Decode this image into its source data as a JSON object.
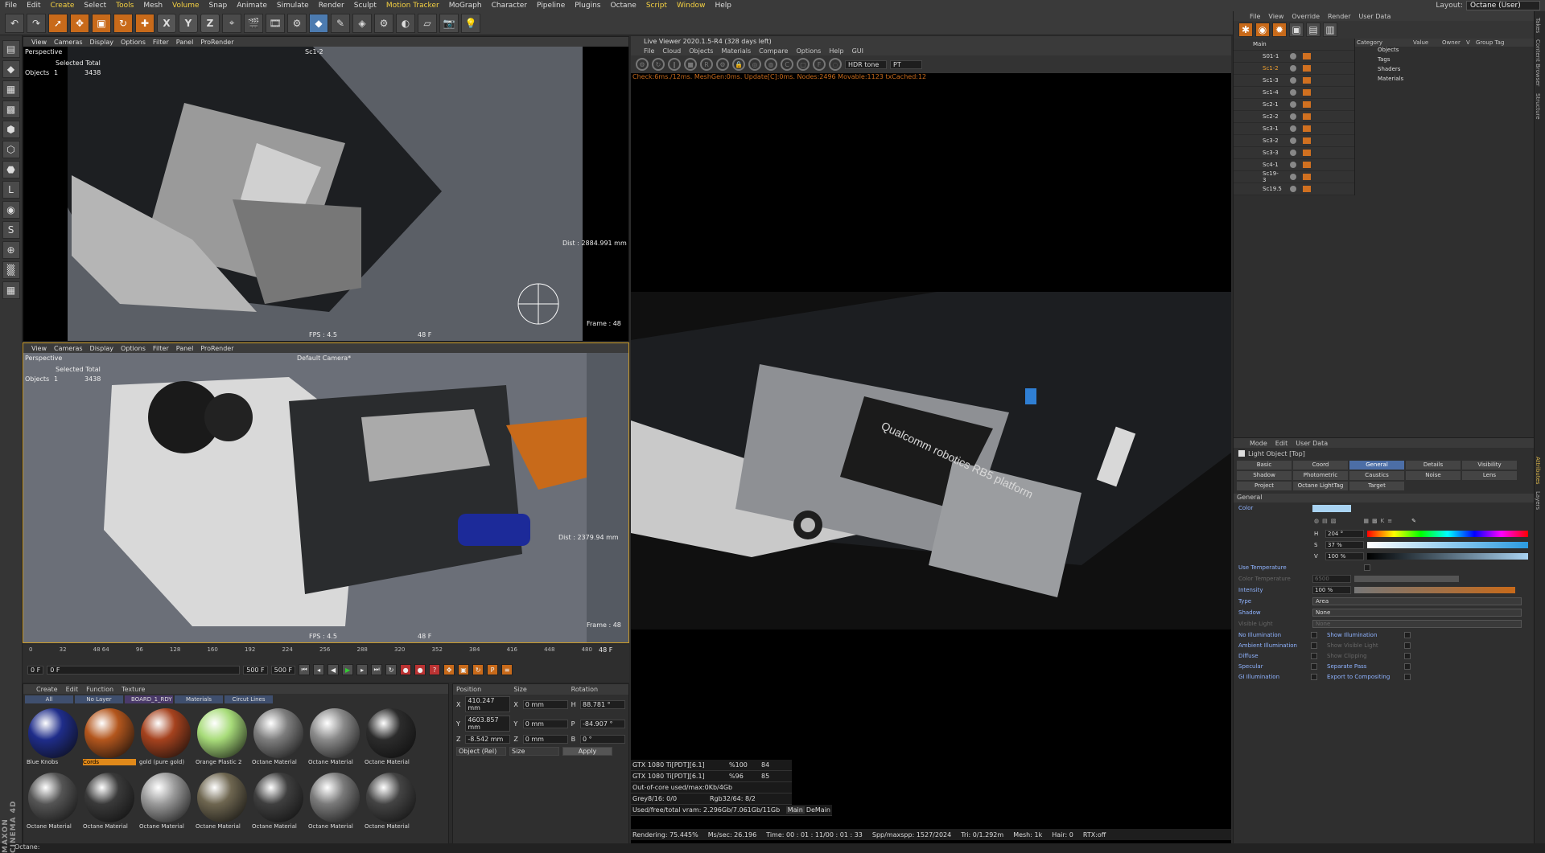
{
  "menubar": {
    "items": [
      "File",
      "Edit",
      "Create",
      "Select",
      "Tools",
      "Mesh",
      "Volume",
      "Snap",
      "Animate",
      "Simulate",
      "Render",
      "Sculpt",
      "Motion Tracker",
      "MoGraph",
      "Character",
      "Pipeline",
      "Plugins",
      "Octane",
      "Script",
      "Window",
      "Help"
    ],
    "layout_label": "Layout:",
    "layout_value": "Octane (User)"
  },
  "viewport_top": {
    "menu": [
      "View",
      "Cameras",
      "Display",
      "Options",
      "Filter",
      "Panel",
      "ProRender"
    ],
    "mode": "Perspective",
    "camera": "Sc1-2",
    "selected_total": "Selected Total",
    "objects_label": "Objects",
    "objects_count": "1",
    "objects_total": "3438",
    "dist": "Dist : 2884.991 mm",
    "fps": "FPS : 4.5",
    "frame_mid": "48 F",
    "frame": "Frame : 48"
  },
  "viewport_bottom": {
    "menu": [
      "View",
      "Cameras",
      "Display",
      "Options",
      "Filter",
      "Panel",
      "ProRender"
    ],
    "mode": "Perspective",
    "camera": "Default Camera*",
    "selected_total": "Selected Total",
    "objects_label": "Objects",
    "objects_count": "1",
    "objects_total": "3438",
    "dist": "Dist : 2379.94 mm",
    "fps": "FPS : 4.5",
    "frame_mid": "48 F",
    "frame": "Frame : 48"
  },
  "timeline": {
    "ticks": [
      "0",
      "32",
      "48 64",
      "96",
      "128",
      "160",
      "192",
      "224",
      "256",
      "288",
      "320",
      "352",
      "384",
      "416",
      "448",
      "480"
    ],
    "end_label": "48 F",
    "start_field": "0 F",
    "current_field": "0 F",
    "max_field": "500 F",
    "max_field2": "500 F"
  },
  "materials": {
    "menu": [
      "Create",
      "Edit",
      "Function",
      "Texture"
    ],
    "filters": [
      "All",
      "No Layer",
      "BOARD_1_RDY",
      "Materials",
      "Circut Lines"
    ],
    "items": [
      {
        "name": "Blue Knobs",
        "color": "#1f2d8a"
      },
      {
        "name": "Cords",
        "color": "#b3561d"
      },
      {
        "name": "gold (pure gold)",
        "color": "#a5421e"
      },
      {
        "name": "Orange Plastic 2",
        "color": "#a8dc7a"
      },
      {
        "name": "Octane Material",
        "color": "#7e7e7e"
      },
      {
        "name": "Octane Material",
        "color": "#8a8a8a"
      },
      {
        "name": "Octane Material",
        "color": "#2c2c2c"
      },
      {
        "name": "Octane Material",
        "color": "#555555"
      },
      {
        "name": "Octane Material",
        "color": "#3a3a3a"
      },
      {
        "name": "Octane Material",
        "color": "#9a9a9a"
      },
      {
        "name": "Octane Material",
        "color": "#6e6650"
      },
      {
        "name": "Octane Material",
        "color": "#3f3f3f"
      },
      {
        "name": "Octane Material",
        "color": "#7a7a7a"
      },
      {
        "name": "Octane Material",
        "color": "#444444"
      }
    ]
  },
  "coords": {
    "headers": [
      "Position",
      "Size",
      "Rotation"
    ],
    "x": "410.247 mm",
    "y": "4603.857 mm",
    "z": "-8.542 mm",
    "sx": "0 mm",
    "sy": "0 mm",
    "sz": "0 mm",
    "h": "88.781 °",
    "p": "-84.907 °",
    "b": "0 °",
    "mode": "Object (Rel)",
    "size_mode": "Size",
    "apply": "Apply"
  },
  "live_viewer": {
    "title": "Live Viewer 2020.1.5-R4 (328 days left)",
    "menu": [
      "File",
      "Cloud",
      "Objects",
      "Materials",
      "Compare",
      "Options",
      "Help",
      "GUI"
    ],
    "tone": "HDR tone",
    "kernel": "PT",
    "stats": "Check:6ms./12ms. MeshGen:0ms. Update[C]:0ms. Nodes:2496 Movable:1123 txCached:12",
    "render_text": "Qualcomm robotics RB5 platform",
    "gpu": [
      {
        "name": "GTX 1080 Ti[PDT][6.1]",
        "pct": "%100",
        "val": "84"
      },
      {
        "name": "GTX 1080 Ti[PDT][6.1]",
        "pct": "%96",
        "val": "85"
      }
    ],
    "ooc": "Out-of-core used/max:0Kb/4Gb",
    "grey": "Grey8/16: 0/0",
    "rgb": "Rgb32/64: 8/2",
    "vram": "Used/free/total vram: 2.296Gb/7.061Gb/11Gb",
    "tab_main": "Main",
    "tab_demain": "DeMain",
    "bottom": {
      "rendering": "Rendering: 75.445%",
      "ms": "Ms/sec: 26.196",
      "time": "Time: 00 : 01 : 11/00 : 01 : 33",
      "spp": "Spp/maxspp: 1527/2024",
      "tri": "Tri: 0/1.292m",
      "mesh": "Mesh: 1k",
      "hair": "Hair: 0",
      "rtx": "RTX:off"
    },
    "progress": 0.75445
  },
  "objmgr": {
    "menu": [
      "File",
      "View",
      "Override",
      "Render",
      "User Data"
    ],
    "root": "Main",
    "rows": [
      "S01-1",
      "Sc1-2",
      "Sc1-3",
      "Sc1-4",
      "Sc2-1",
      "Sc2-2",
      "Sc3-1",
      "Sc3-2",
      "Sc3-3",
      "Sc4-1",
      "Sc19-3",
      "Sc19.5"
    ],
    "cols": [
      "Category",
      "Value",
      "Owner",
      "V",
      "Group Tag"
    ],
    "cats": [
      "Objects",
      "Tags",
      "Shaders",
      "Materials"
    ]
  },
  "sidetabs": [
    "Takes",
    "Content Browser",
    "Structure",
    "Attributes",
    "Layers"
  ],
  "attr": {
    "menu": [
      "Mode",
      "Edit",
      "User Data"
    ],
    "title": "Light Object [Top]",
    "tabs": [
      "Basic",
      "Coord",
      "General",
      "Details",
      "Visibility",
      "Shadow",
      "Photometric",
      "Caustics",
      "Noise",
      "Lens",
      "Project",
      "Octane LightTag",
      "Target"
    ],
    "section": "General",
    "color_label": "Color",
    "h_label": "H",
    "h": "204 °",
    "s_label": "S",
    "s": "37 %",
    "v_label": "V",
    "v": "100 %",
    "use_temp": "Use Temperature",
    "color_temp": "Color Temperature",
    "color_temp_val": "6500",
    "intensity": "Intensity",
    "intensity_val": "100 %",
    "type": "Type",
    "type_val": "Area",
    "shadow": "Shadow",
    "shadow_val": "None",
    "visible_light": "Visible Light",
    "visible_light_val": "None",
    "checks": [
      {
        "a": "No Illumination",
        "b": "Show Illumination"
      },
      {
        "a": "Ambient Illumination",
        "b": "Show Visible Light"
      },
      {
        "a": "Diffuse",
        "b": "Show Clipping"
      },
      {
        "a": "Specular",
        "b": "Separate Pass"
      },
      {
        "a": "GI Illumination",
        "b": "Export to Compositing"
      }
    ],
    "light_color": "#a9d3f2"
  },
  "status": "Octane:",
  "brand": "MAXON CINEMA 4D"
}
